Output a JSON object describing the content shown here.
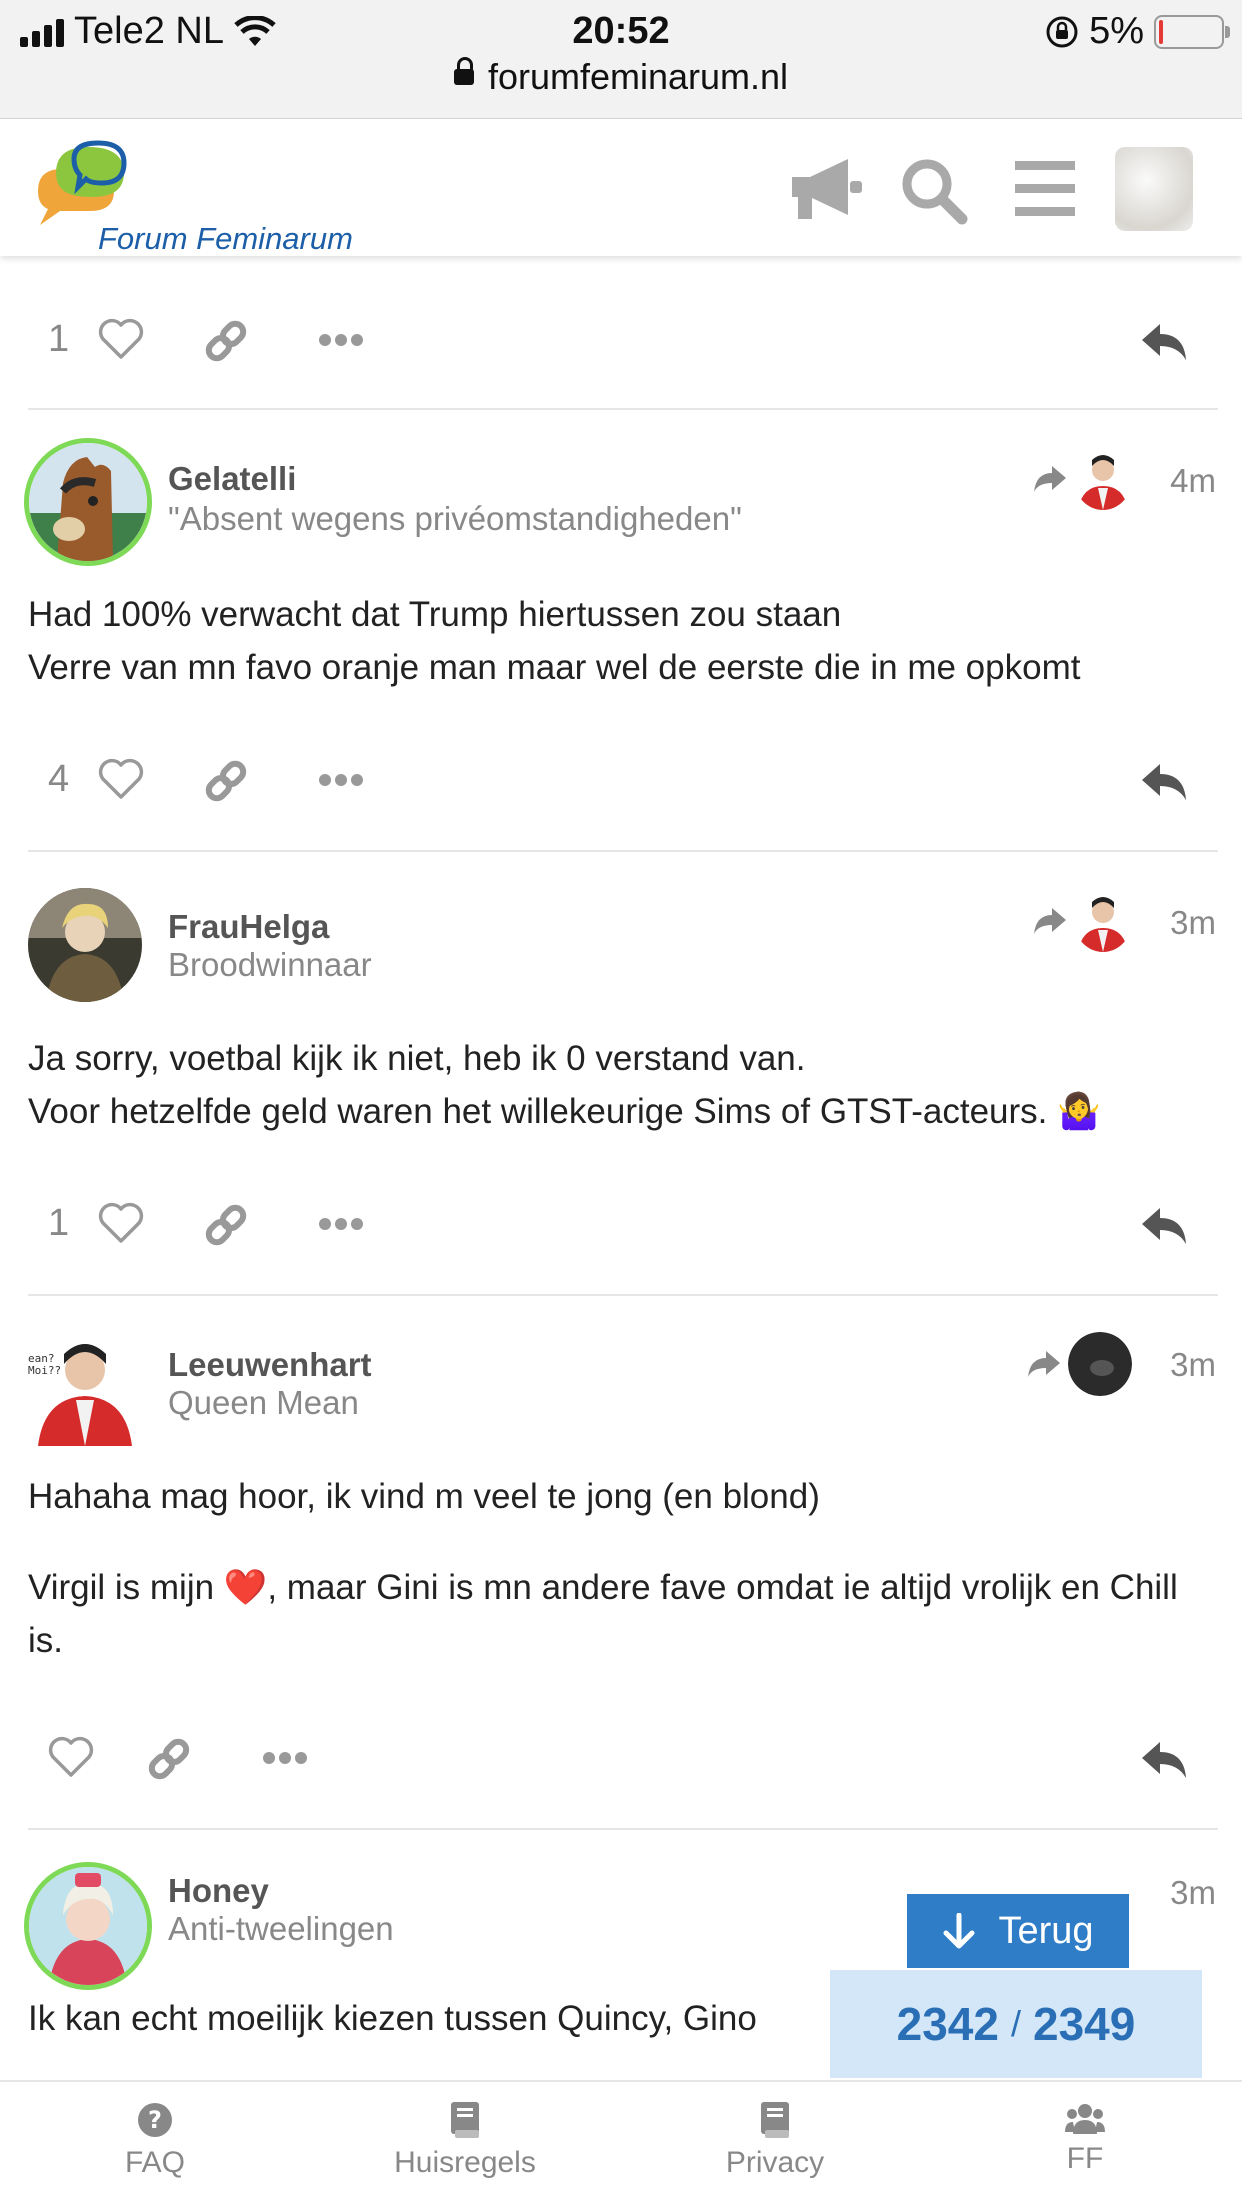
{
  "status_bar": {
    "carrier": "Tele2 NL",
    "time": "20:52",
    "battery": "5%",
    "battery_level": 0.05,
    "url": "forumfeminarum.nl"
  },
  "site": {
    "name": "Forum Feminarum"
  },
  "header_icons": [
    "megaphone-icon",
    "search-icon",
    "hamburger-menu-icon",
    "user-avatar"
  ],
  "top_actions": {
    "likes": "1"
  },
  "posts": [
    {
      "username": "Gelatelli",
      "title": "\"Absent wegens privéomstandigheden\"",
      "time": "4m",
      "lines": [
        "Had 100% verwacht dat Trump hiertussen zou staan",
        "Verre van mn favo oranje man maar wel de eerste die in me opkomt"
      ],
      "likes": "4"
    },
    {
      "username": "FrauHelga",
      "title": "Broodwinnaar",
      "time": "3m",
      "lines": [
        "Ja sorry, voetbal kijk ik niet, heb ik 0 verstand van.",
        "Voor hetzelfde geld waren het willekeurige Sims of GTST-acteurs. 🤷‍♀️"
      ],
      "likes": "1"
    },
    {
      "username": "Leeuwenhart",
      "title": "Queen Mean",
      "time": "3m",
      "lines": [
        "Hahaha mag hoor, ik vind m veel te jong (en blond)",
        "Virgil is mijn ❤️, maar Gini is mn andere fave omdat ie altijd vrolijk en Chill is."
      ],
      "likes": ""
    },
    {
      "username": "Honey",
      "title": "Anti-tweelingen",
      "time": "3m",
      "lines": [
        "Ik kan echt moeilijk kiezen tussen Quincy, Gino"
      ]
    }
  ],
  "jump_button": {
    "label": "Terug"
  },
  "progress": {
    "current": "2342",
    "separator": "/",
    "total": "2349"
  },
  "bottom_nav": [
    {
      "label": "FAQ",
      "icon": "question-icon"
    },
    {
      "label": "Huisregels",
      "icon": "book-icon"
    },
    {
      "label": "Privacy",
      "icon": "book-icon"
    },
    {
      "label": "FF",
      "icon": "group-icon"
    }
  ],
  "colors": {
    "accent": "#2f7dc6",
    "progress_bg": "#d4e7f8",
    "avatar_ring": "#7ed957"
  }
}
